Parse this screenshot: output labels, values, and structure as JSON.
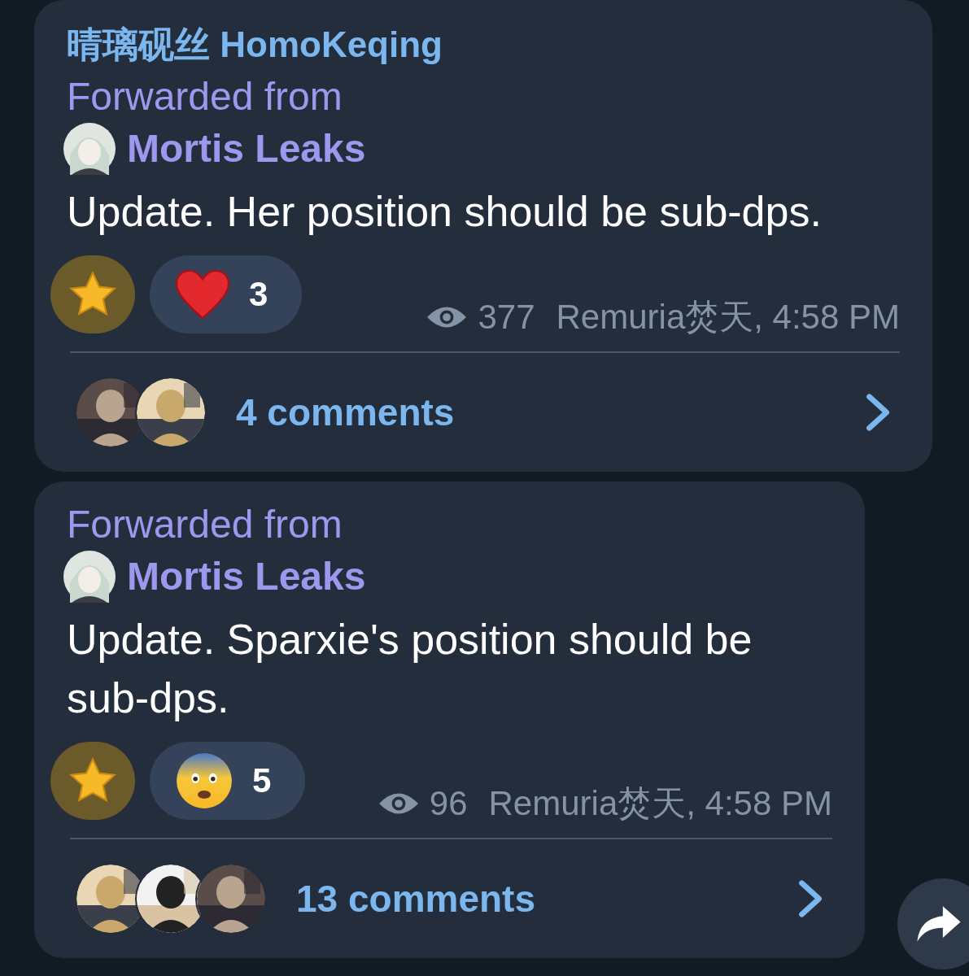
{
  "messages": [
    {
      "sender": "晴璃砚丝 HomoKeqing",
      "forwarded_label": "Forwarded from",
      "forwarded_source": "Mortis Leaks",
      "text": "Update. Her position should be sub-dps.",
      "reactions": [
        {
          "kind": "star"
        },
        {
          "kind": "heart",
          "count": "3"
        }
      ],
      "views": "377",
      "signature": "Remuria焚天, 4:58 PM",
      "commenters": [
        {
          "kind": "picture"
        },
        {
          "kind": "picture"
        }
      ],
      "comments": "4 comments"
    },
    {
      "forwarded_label": "Forwarded from",
      "forwarded_source": "Mortis Leaks",
      "text": "Update. Sparxie's position should be sub-dps.",
      "reactions": [
        {
          "kind": "star"
        },
        {
          "kind": "fear",
          "count": "5"
        }
      ],
      "views": "96",
      "signature": "Remuria焚天, 4:58 PM",
      "commenters": [
        {
          "kind": "picture"
        },
        {
          "kind": "picture"
        },
        {
          "kind": "picture"
        }
      ],
      "comments": "13 comments"
    }
  ]
}
